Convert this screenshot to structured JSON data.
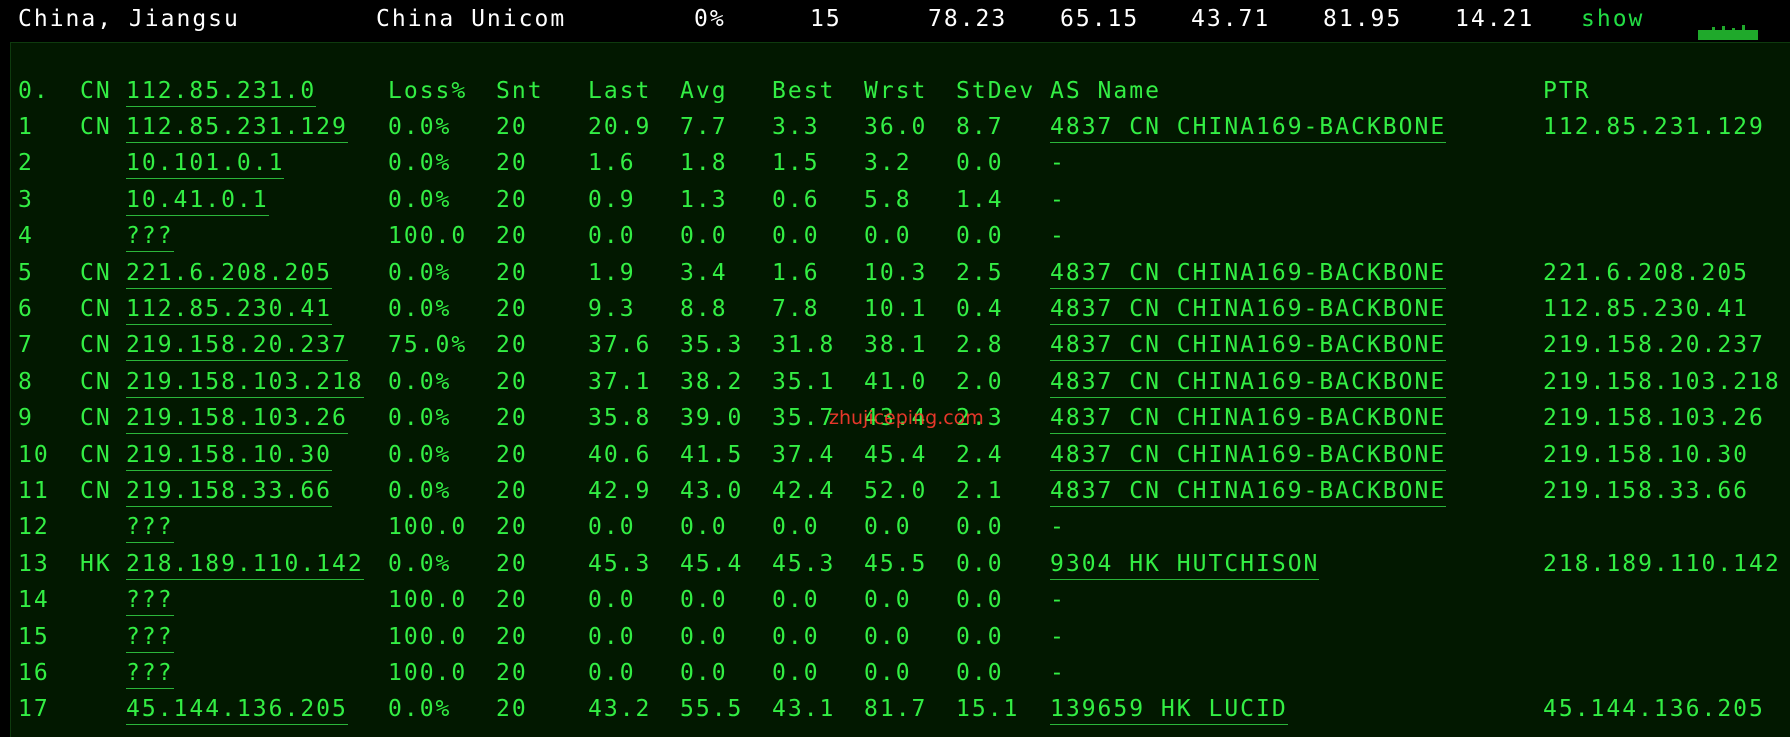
{
  "summary": {
    "location": "China, Jiangsu",
    "isp": "China Unicom",
    "loss": "0%",
    "sent": "15",
    "last": "78.23",
    "avg": "65.15",
    "best": "43.71",
    "worst": "81.95",
    "stdev": "14.21",
    "show_label": "show",
    "sparkline_color": "#1fa92b"
  },
  "table": {
    "columns": {
      "hop": "0.",
      "cc": "CN",
      "host": "112.85.231.0",
      "loss": "Loss%",
      "snt": "Snt",
      "last": "Last",
      "avg": "Avg",
      "best": "Best",
      "wrst": "Wrst",
      "stdev": "StDev",
      "as": "AS Name",
      "ptr": "PTR"
    },
    "rows": [
      {
        "hop": "1",
        "cc": "CN",
        "host": "112.85.231.129",
        "loss": "0.0%",
        "snt": "20",
        "last": "20.9",
        "avg": "7.7",
        "best": "3.3",
        "wrst": "36.0",
        "stdev": "8.7",
        "as": "4837  CN CHINA169-BACKBONE",
        "ptr": "112.85.231.129"
      },
      {
        "hop": "2",
        "cc": "",
        "host": "10.101.0.1",
        "loss": "0.0%",
        "snt": "20",
        "last": "1.6",
        "avg": "1.8",
        "best": "1.5",
        "wrst": "3.2",
        "stdev": "0.0",
        "as": "-",
        "ptr": ""
      },
      {
        "hop": "3",
        "cc": "",
        "host": "10.41.0.1",
        "loss": "0.0%",
        "snt": "20",
        "last": "0.9",
        "avg": "1.3",
        "best": "0.6",
        "wrst": "5.8",
        "stdev": "1.4",
        "as": "-",
        "ptr": ""
      },
      {
        "hop": "4",
        "cc": "",
        "host": "???",
        "loss": "100.0",
        "snt": "20",
        "last": "0.0",
        "avg": "0.0",
        "best": "0.0",
        "wrst": "0.0",
        "stdev": "0.0",
        "as": "-",
        "ptr": ""
      },
      {
        "hop": "5",
        "cc": "CN",
        "host": "221.6.208.205",
        "loss": "0.0%",
        "snt": "20",
        "last": "1.9",
        "avg": "3.4",
        "best": "1.6",
        "wrst": "10.3",
        "stdev": "2.5",
        "as": "4837  CN CHINA169-BACKBONE",
        "ptr": "221.6.208.205"
      },
      {
        "hop": "6",
        "cc": "CN",
        "host": "112.85.230.41",
        "loss": "0.0%",
        "snt": "20",
        "last": "9.3",
        "avg": "8.8",
        "best": "7.8",
        "wrst": "10.1",
        "stdev": "0.4",
        "as": "4837  CN CHINA169-BACKBONE",
        "ptr": "112.85.230.41"
      },
      {
        "hop": "7",
        "cc": "CN",
        "host": "219.158.20.237",
        "loss": "75.0%",
        "snt": "20",
        "last": "37.6",
        "avg": "35.3",
        "best": "31.8",
        "wrst": "38.1",
        "stdev": "2.8",
        "as": "4837  CN CHINA169-BACKBONE",
        "ptr": "219.158.20.237"
      },
      {
        "hop": "8",
        "cc": "CN",
        "host": "219.158.103.218",
        "loss": "0.0%",
        "snt": "20",
        "last": "37.1",
        "avg": "38.2",
        "best": "35.1",
        "wrst": "41.0",
        "stdev": "2.0",
        "as": "4837  CN CHINA169-BACKBONE",
        "ptr": "219.158.103.218"
      },
      {
        "hop": "9",
        "cc": "CN",
        "host": "219.158.103.26",
        "loss": "0.0%",
        "snt": "20",
        "last": "35.8",
        "avg": "39.0",
        "best": "35.7",
        "wrst": "43.4",
        "stdev": "2.3",
        "as": "4837  CN CHINA169-BACKBONE",
        "ptr": "219.158.103.26"
      },
      {
        "hop": "10",
        "cc": "CN",
        "host": "219.158.10.30",
        "loss": "0.0%",
        "snt": "20",
        "last": "40.6",
        "avg": "41.5",
        "best": "37.4",
        "wrst": "45.4",
        "stdev": "2.4",
        "as": "4837  CN CHINA169-BACKBONE",
        "ptr": "219.158.10.30"
      },
      {
        "hop": "11",
        "cc": "CN",
        "host": "219.158.33.66",
        "loss": "0.0%",
        "snt": "20",
        "last": "42.9",
        "avg": "43.0",
        "best": "42.4",
        "wrst": "52.0",
        "stdev": "2.1",
        "as": "4837  CN CHINA169-BACKBONE",
        "ptr": "219.158.33.66"
      },
      {
        "hop": "12",
        "cc": "",
        "host": "???",
        "loss": "100.0",
        "snt": "20",
        "last": "0.0",
        "avg": "0.0",
        "best": "0.0",
        "wrst": "0.0",
        "stdev": "0.0",
        "as": "-",
        "ptr": ""
      },
      {
        "hop": "13",
        "cc": "HK",
        "host": "218.189.110.142",
        "loss": "0.0%",
        "snt": "20",
        "last": "45.3",
        "avg": "45.4",
        "best": "45.3",
        "wrst": "45.5",
        "stdev": "0.0",
        "as": "9304  HK HUTCHISON",
        "ptr": "218.189.110.142"
      },
      {
        "hop": "14",
        "cc": "",
        "host": "???",
        "loss": "100.0",
        "snt": "20",
        "last": "0.0",
        "avg": "0.0",
        "best": "0.0",
        "wrst": "0.0",
        "stdev": "0.0",
        "as": "-",
        "ptr": ""
      },
      {
        "hop": "15",
        "cc": "",
        "host": "???",
        "loss": "100.0",
        "snt": "20",
        "last": "0.0",
        "avg": "0.0",
        "best": "0.0",
        "wrst": "0.0",
        "stdev": "0.0",
        "as": "-",
        "ptr": ""
      },
      {
        "hop": "16",
        "cc": "",
        "host": "???",
        "loss": "100.0",
        "snt": "20",
        "last": "0.0",
        "avg": "0.0",
        "best": "0.0",
        "wrst": "0.0",
        "stdev": "0.0",
        "as": "-",
        "ptr": ""
      },
      {
        "hop": "17",
        "cc": "",
        "host": "45.144.136.205",
        "loss": "0.0%",
        "snt": "20",
        "last": "43.2",
        "avg": "55.5",
        "best": "43.1",
        "wrst": "81.7",
        "stdev": "15.1",
        "as": "139659 HK LUCID",
        "ptr": "45.144.136.205"
      }
    ]
  },
  "watermark": "zhujiceping.com"
}
